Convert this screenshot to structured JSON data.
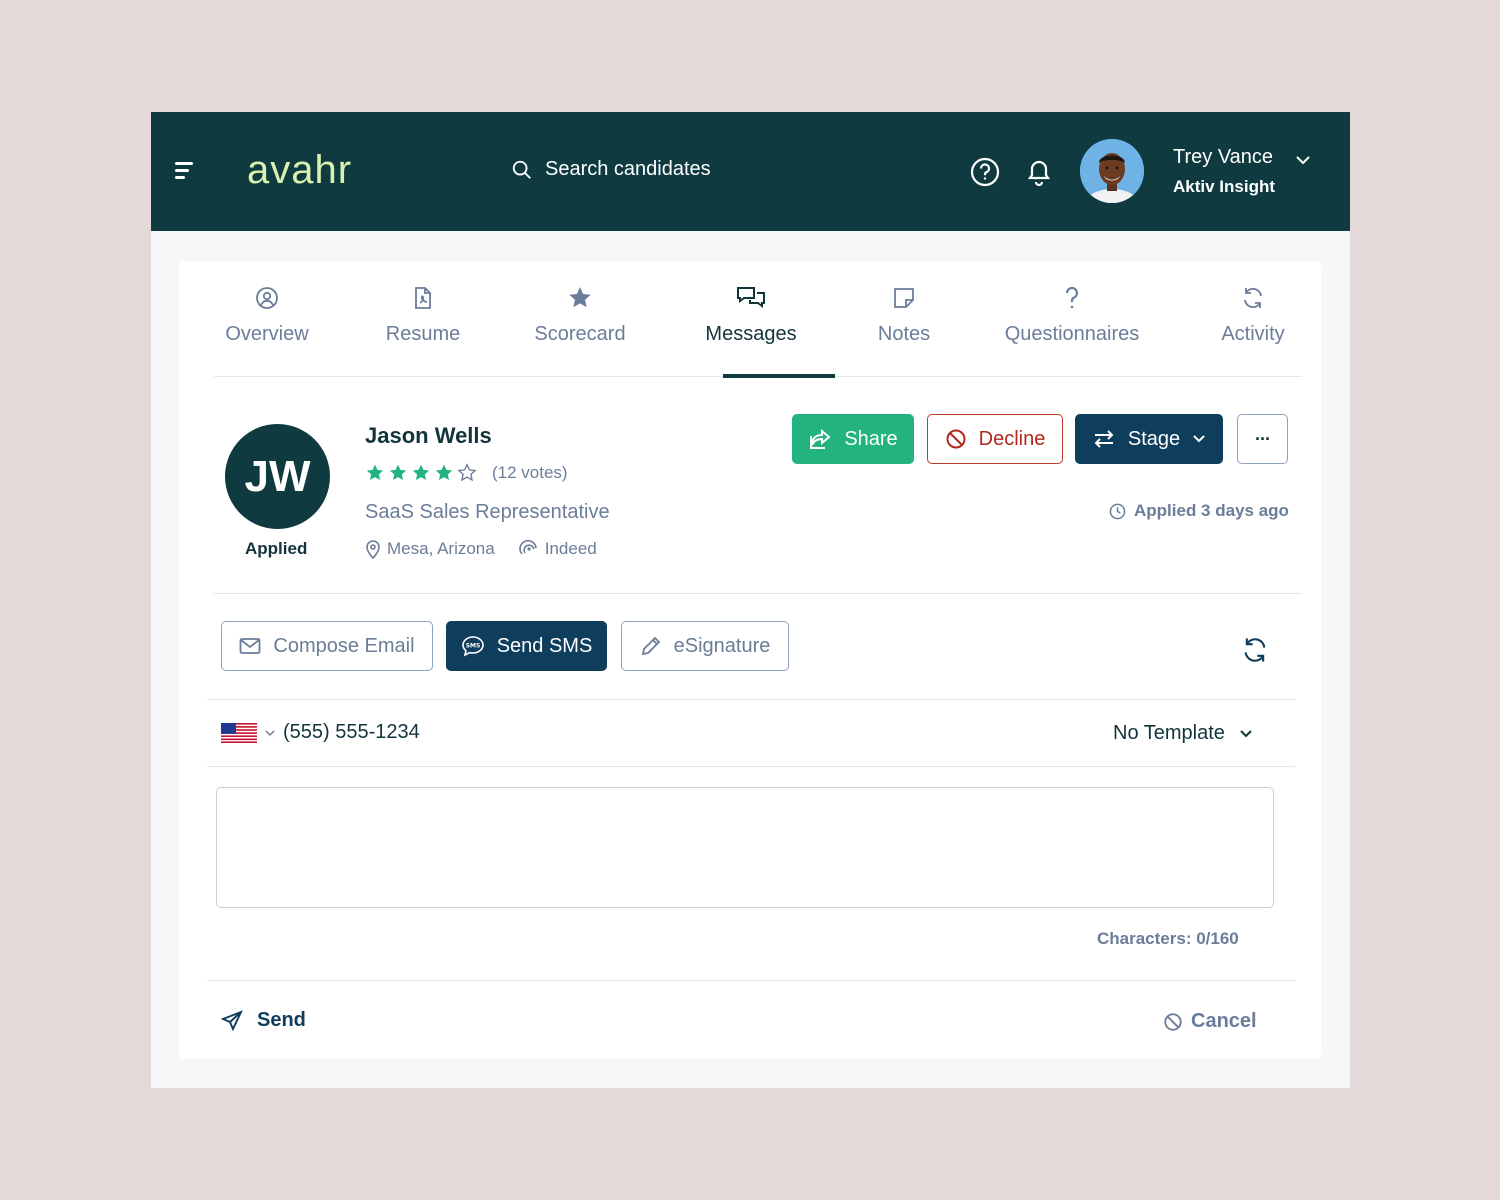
{
  "app": {
    "logo_text": "avahr",
    "search_placeholder": "Search candidates",
    "user": {
      "name": "Trey Vance",
      "org": "Aktiv Insight"
    }
  },
  "tabs": [
    {
      "label": "Overview",
      "icon": "user-circle-icon"
    },
    {
      "label": "Resume",
      "icon": "pdf-file-icon"
    },
    {
      "label": "Scorecard",
      "icon": "star-icon"
    },
    {
      "label": "Messages",
      "icon": "chat-bubbles-icon",
      "active": true
    },
    {
      "label": "Notes",
      "icon": "sticky-note-icon"
    },
    {
      "label": "Questionnaires",
      "icon": "question-mark-icon"
    },
    {
      "label": "Activity",
      "icon": "refresh-icon"
    }
  ],
  "candidate": {
    "initials": "JW",
    "status": "Applied",
    "name": "Jason Wells",
    "rating": 4,
    "rating_max": 5,
    "votes": "(12 votes)",
    "job_title": "SaaS Sales Representative",
    "location": "Mesa, Arizona",
    "source": "Indeed",
    "applied_time": "Applied 3 days ago"
  },
  "actions": {
    "share": "Share",
    "decline": "Decline",
    "stage": "Stage",
    "more": "···"
  },
  "message_modes": {
    "compose_email": "Compose Email",
    "send_sms": "Send SMS",
    "esignature": "eSignature"
  },
  "sms": {
    "country_flag": "US",
    "phone": "(555) 555-1234",
    "template": "No Template",
    "message": "",
    "char_count": "Characters: 0/160",
    "send_label": "Send",
    "cancel_label": "Cancel"
  },
  "colors": {
    "header_bg": "#0e3a40",
    "logo": "#d9f2b0",
    "share_green": "#22b37e",
    "decline_red": "#b02a1e",
    "primary_navy": "#0f3d5c",
    "muted_text": "#6b7d99",
    "star_green": "#22b37e"
  }
}
